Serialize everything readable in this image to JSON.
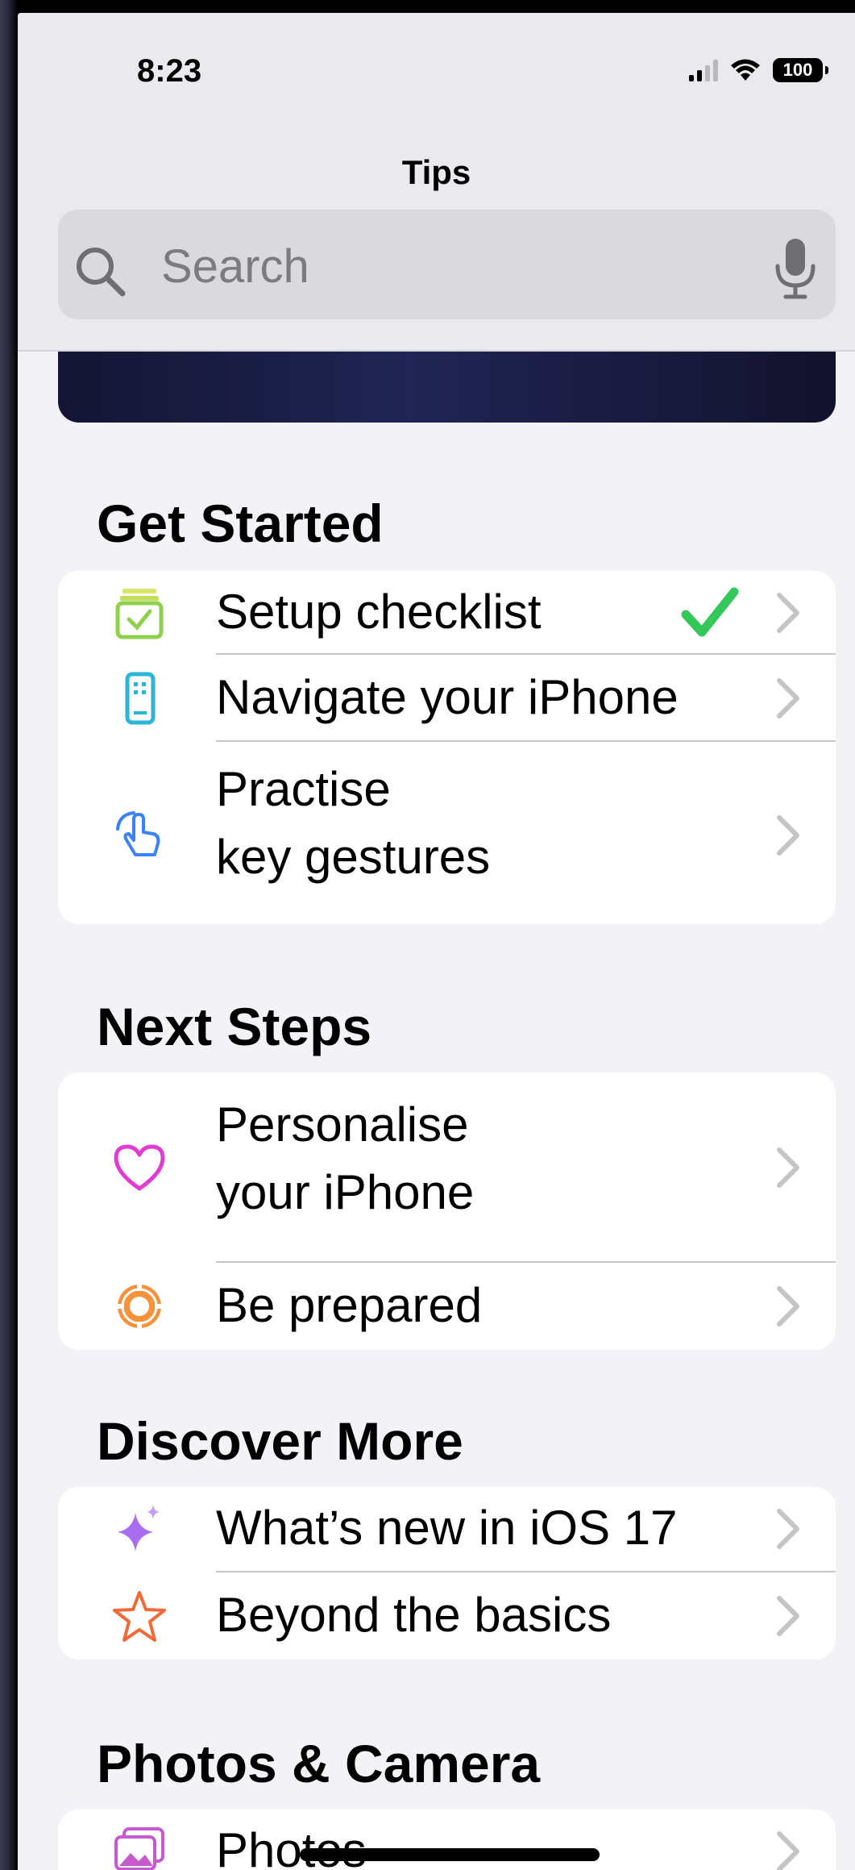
{
  "status_bar": {
    "time": "8:23",
    "battery": "100"
  },
  "nav": {
    "title": "Tips"
  },
  "search": {
    "placeholder": "Search"
  },
  "sections": {
    "get_started": {
      "title": "Get Started",
      "items": [
        {
          "label": "Setup checklist",
          "icon": "checklist-icon",
          "completed": true
        },
        {
          "label": "Navigate your iPhone",
          "icon": "iphone-icon"
        },
        {
          "label_line1": "Practise",
          "label_line2": "key gestures",
          "icon": "hand-gesture-icon"
        }
      ]
    },
    "next_steps": {
      "title": "Next Steps",
      "items": [
        {
          "label_line1": "Personalise",
          "label_line2": "your iPhone",
          "icon": "heart-icon"
        },
        {
          "label": "Be prepared",
          "icon": "lifebuoy-icon"
        }
      ]
    },
    "discover_more": {
      "title": "Discover More",
      "items": [
        {
          "label": "What’s new in iOS 17",
          "icon": "sparkles-icon"
        },
        {
          "label": "Beyond the basics",
          "icon": "star-icon"
        }
      ]
    },
    "photos_camera": {
      "title": "Photos & Camera",
      "items": [
        {
          "label": "Photos",
          "icon": "photos-icon"
        }
      ]
    }
  },
  "colors": {
    "background": "#f2f2f7",
    "card": "#ffffff",
    "checkmark": "#34c759",
    "chevron": "#c4c4c7",
    "heart": "#e23bd0",
    "lifebuoy": "#f7913a",
    "star": "#f26a3a",
    "sparkles": "#a96df2",
    "gesture": "#3b82f6",
    "iphone": "#2bb6d6"
  }
}
